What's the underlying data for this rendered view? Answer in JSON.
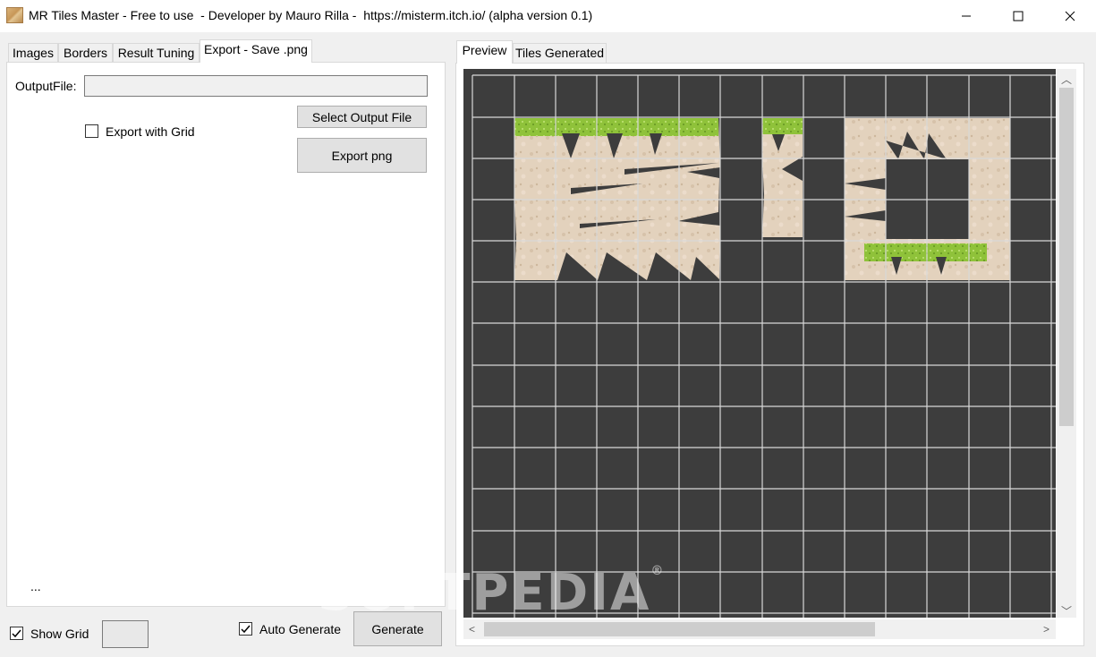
{
  "window": {
    "title": "MR Tiles Master - Free to use  - Developer by Mauro Rilla -  https://misterm.itch.io/ (alpha version 0.1)",
    "icons": [
      "app-icon",
      "minimize-icon",
      "maximize-icon",
      "close-icon"
    ]
  },
  "left_tabs": [
    {
      "label": "Images",
      "active": false
    },
    {
      "label": "Borders",
      "active": false
    },
    {
      "label": "Result Tuning",
      "active": false
    },
    {
      "label": "Export - Save .png",
      "active": true
    }
  ],
  "export": {
    "output_label": "OutputFile:",
    "output_value": "",
    "select_button": "Select Output File",
    "export_button": "Export png",
    "grid_checkbox_label": "Export with Grid",
    "grid_checked": false,
    "ellipsis": "..."
  },
  "footer": {
    "show_grid_label": "Show Grid",
    "show_grid_checked": true,
    "auto_generate_label": "Auto Generate",
    "auto_generate_checked": true,
    "generate_button": "Generate"
  },
  "right_tabs": [
    {
      "label": "Preview",
      "active": true
    },
    {
      "label": "Tiles Generated",
      "active": false
    }
  ],
  "preview": {
    "background": "#3d3d3d",
    "grid_color": "#d8d8d8",
    "sand_color": "#e3d2bd",
    "grass_color": "#8fc23a"
  },
  "watermark": {
    "text": "SOFTPEDIA",
    "mark": "®"
  }
}
